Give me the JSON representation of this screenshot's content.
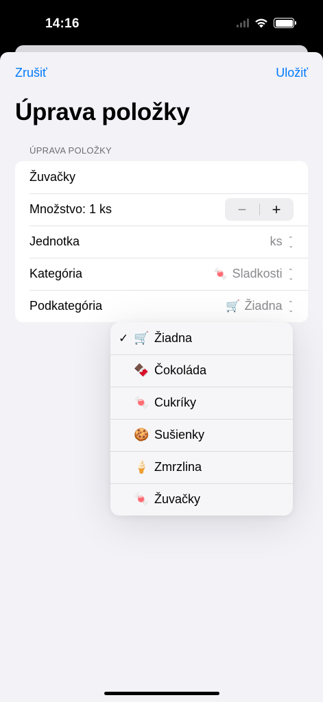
{
  "status": {
    "time": "14:16"
  },
  "nav": {
    "cancel": "Zrušiť",
    "save": "Uložiť"
  },
  "title": "Úprava položky",
  "section_header": "ÚPRAVA POLOŽKY",
  "form": {
    "name_value": "Žuvačky",
    "quantity_label": "Množstvo: 1 ks",
    "stepper_minus": "−",
    "stepper_plus": "+",
    "unit_label": "Jednotka",
    "unit_value": "ks",
    "category_label": "Kategória",
    "category_emoji": "🍬",
    "category_value": "Sladkosti",
    "subcategory_label": "Podkategória",
    "subcategory_emoji": "🛒",
    "subcategory_value": "Žiadna"
  },
  "menu": {
    "selected_mark": "✓",
    "items": [
      {
        "emoji": "🛒",
        "label": "Žiadna"
      },
      {
        "emoji": "🍫",
        "label": "Čokoláda"
      },
      {
        "emoji": "🍬",
        "label": "Cukríky"
      },
      {
        "emoji": "🍪",
        "label": "Sušienky"
      },
      {
        "emoji": "🍦",
        "label": "Zmrzlina"
      },
      {
        "emoji": "🍬",
        "label": "Žuvačky"
      }
    ]
  },
  "colors": {
    "accent": "#007aff",
    "background": "#f2f2f7",
    "secondary_text": "#8a8a8e"
  }
}
